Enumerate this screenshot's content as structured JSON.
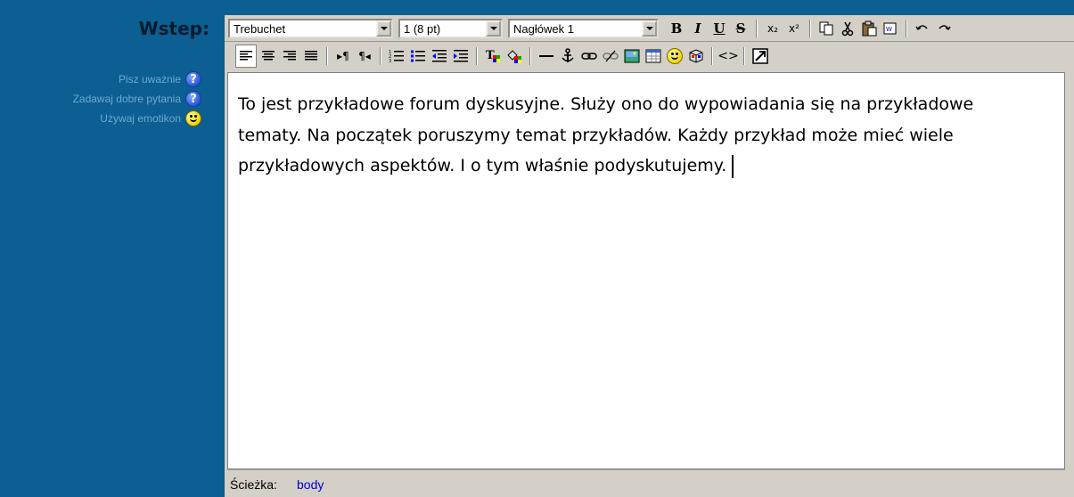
{
  "sidebar": {
    "field_label": "Wstep:",
    "tips": [
      {
        "text": "Pisz uważnie",
        "icon": "help-icon"
      },
      {
        "text": "Zadawaj dobre pytania",
        "icon": "help-icon"
      },
      {
        "text": "Używaj emotikon",
        "icon": "smiley-icon"
      }
    ]
  },
  "toolbar": {
    "font_family": "Trebuchet",
    "font_size": "1 (8 pt)",
    "format_block": "Nagłówek 1",
    "bold": "B",
    "italic": "I",
    "underline": "U",
    "strikethrough": "S",
    "subscript": "x₂",
    "superscript": "x²",
    "source_code": "<>"
  },
  "editor": {
    "content": "To jest przykładowe forum dyskusyjne. Służy ono do wypowiadania się na przykładowe tematy. Na początek poruszymy temat przykładów. Każdy przykład może mieć wiele przykładowych aspektów. I o tym właśnie podyskutujemy."
  },
  "status_bar": {
    "path_label": "Ścieżka:",
    "path_item": "body"
  },
  "colors": {
    "sidebar_background": "#0b5f92",
    "toolbar_background": "#d4d0c8",
    "tip_text": "#6ea9d3",
    "path_link": "#0000cc"
  }
}
